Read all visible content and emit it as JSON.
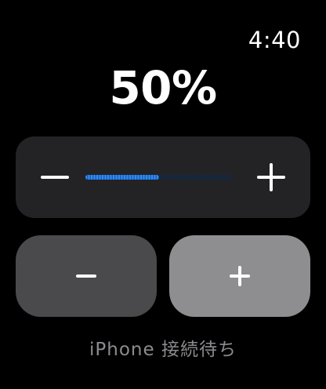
{
  "status_bar": {
    "time": "4:40"
  },
  "volume": {
    "level_text": "50%",
    "level_fraction": 0.5
  },
  "slider": {
    "decrease_icon": "minus-icon",
    "increase_icon": "plus-icon"
  },
  "buttons": {
    "decrease_icon": "minus-icon",
    "increase_icon": "plus-icon"
  },
  "footer": {
    "status_text": "iPhone 接続待ち"
  },
  "colors": {
    "background": "#000000",
    "accent": "#2d8cff",
    "card": "#232325",
    "button_dark": "#4a4a4c",
    "button_light": "#8e8e91",
    "secondary_text": "#8c8c90"
  }
}
